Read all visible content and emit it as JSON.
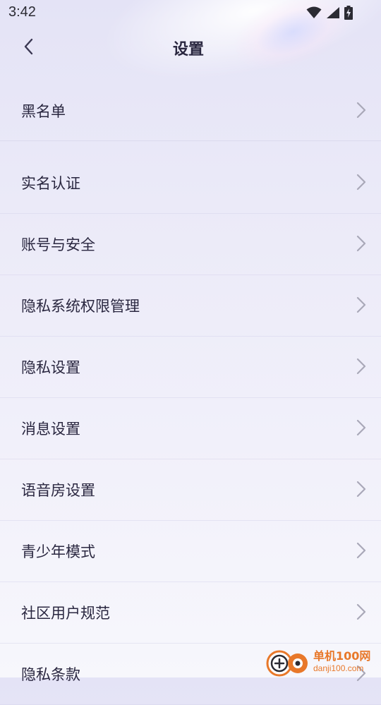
{
  "status_bar": {
    "time": "3:42",
    "icons": [
      "wifi-icon",
      "cell-signal-icon",
      "battery-charging-icon"
    ]
  },
  "header": {
    "title": "设置",
    "back_icon": "chevron-left-icon"
  },
  "menu": {
    "items": [
      {
        "label": "黑名单"
      },
      {
        "label": "实名认证"
      },
      {
        "label": "账号与安全"
      },
      {
        "label": "隐私系统权限管理"
      },
      {
        "label": "隐私设置"
      },
      {
        "label": "消息设置"
      },
      {
        "label": "语音房设置"
      },
      {
        "label": "青少年模式"
      },
      {
        "label": "社区用户规范"
      },
      {
        "label": "隐私条款"
      }
    ],
    "chevron_icon": "chevron-right-icon"
  },
  "watermark": {
    "brand_cn": "单机100网",
    "brand_en": "danji100.com"
  },
  "colors": {
    "text": "#2a2740",
    "chevron": "#a9a8b8",
    "watermark": "#e8782a"
  }
}
